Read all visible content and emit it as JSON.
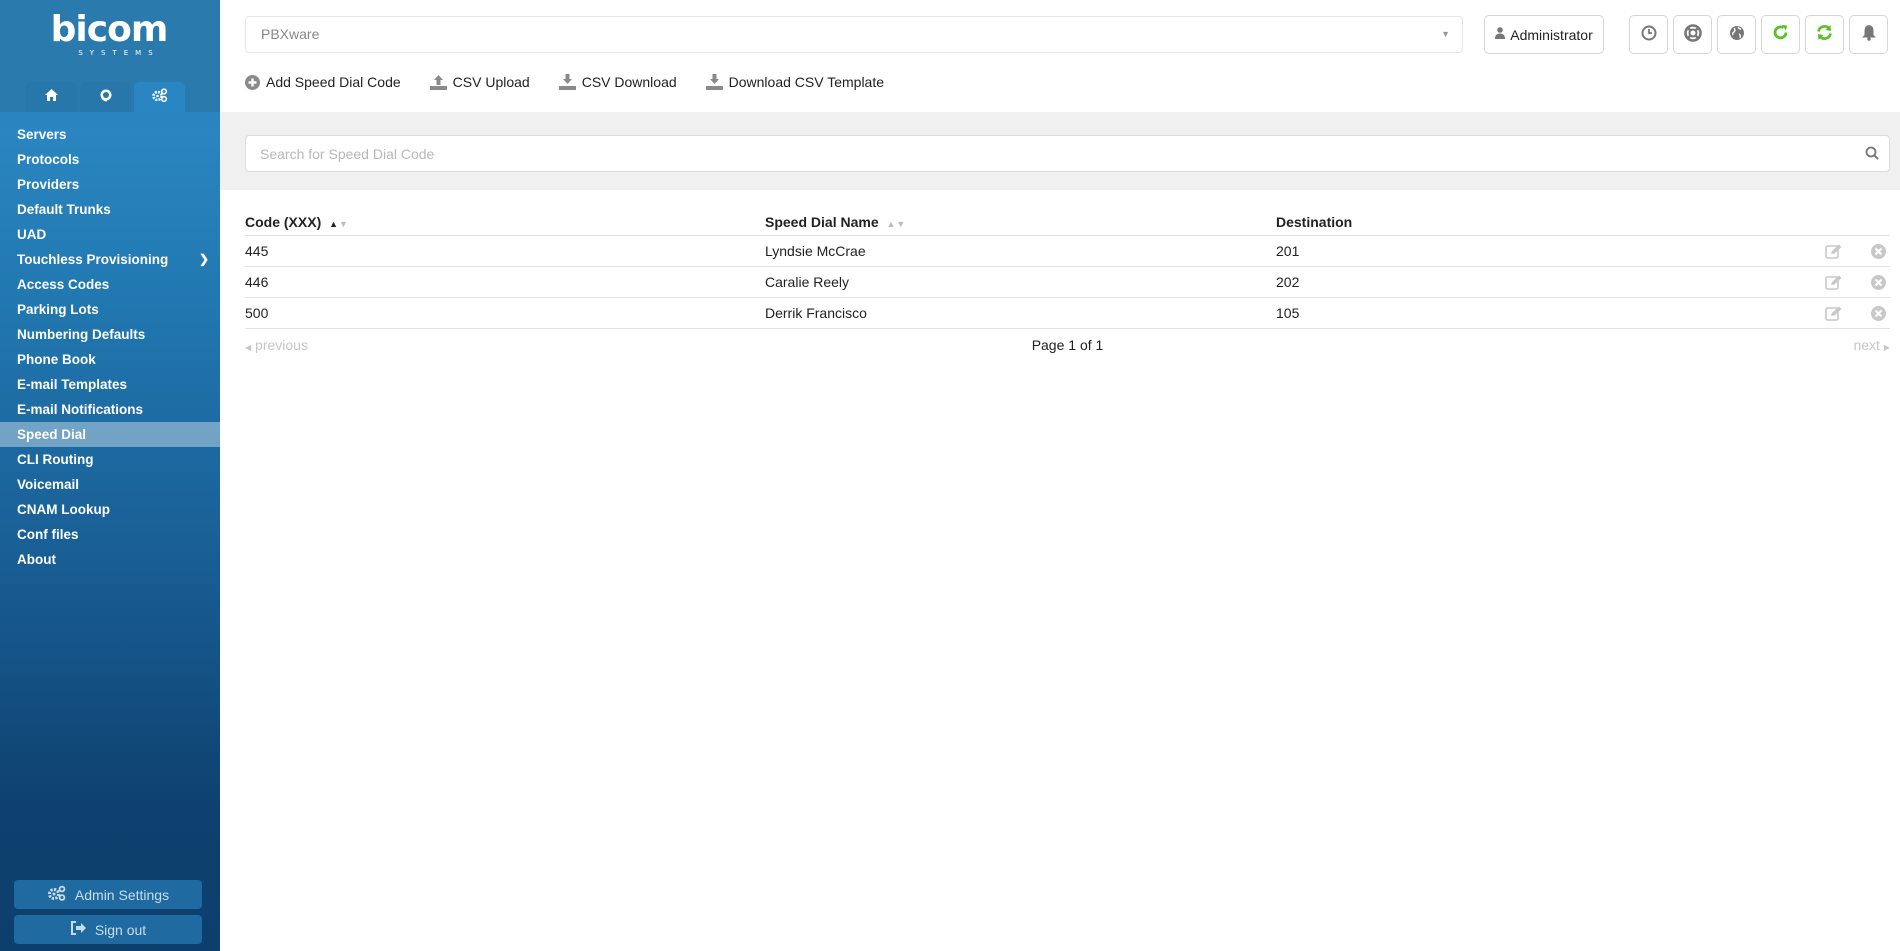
{
  "brand": {
    "name": "bicom",
    "tagline": "SYSTEMS"
  },
  "sidebar": {
    "tabs": [
      {
        "name": "home",
        "icon": "home-icon",
        "active": false
      },
      {
        "name": "support",
        "icon": "headset-icon",
        "active": false
      },
      {
        "name": "settings",
        "icon": "gears-icon",
        "active": true
      }
    ],
    "items": [
      {
        "label": "Servers"
      },
      {
        "label": "Protocols"
      },
      {
        "label": "Providers"
      },
      {
        "label": "Default Trunks"
      },
      {
        "label": "UAD"
      },
      {
        "label": "Touchless Provisioning",
        "has_submenu": true
      },
      {
        "label": "Access Codes"
      },
      {
        "label": "Parking Lots"
      },
      {
        "label": "Numbering Defaults"
      },
      {
        "label": "Phone Book"
      },
      {
        "label": "E-mail Templates"
      },
      {
        "label": "E-mail Notifications"
      },
      {
        "label": "Speed Dial",
        "active": true
      },
      {
        "label": "CLI Routing"
      },
      {
        "label": "Voicemail"
      },
      {
        "label": "CNAM Lookup"
      },
      {
        "label": "Conf files"
      },
      {
        "label": "About"
      }
    ],
    "admin_settings_label": "Admin Settings",
    "sign_out_label": "Sign out"
  },
  "header": {
    "server_select": {
      "value": "PBXware"
    },
    "user_label": "Administrator",
    "icon_buttons": [
      "clock-icon",
      "life-ring-icon",
      "globe-icon",
      "reload-icon",
      "sync-icon",
      "bell-icon"
    ],
    "accent_green": "#5bbf2a"
  },
  "toolbar": {
    "add_label": "Add Speed Dial Code",
    "csv_upload_label": "CSV Upload",
    "csv_download_label": "CSV Download",
    "template_label": "Download CSV Template"
  },
  "search": {
    "placeholder": "Search for Speed Dial Code",
    "value": ""
  },
  "table": {
    "columns": [
      "Code (XXX)",
      "Speed Dial Name",
      "Destination"
    ],
    "sort": {
      "column": "Code (XXX)",
      "direction": "asc"
    },
    "rows": [
      {
        "code": "445",
        "name": "Lyndsie McCrae",
        "destination": "201"
      },
      {
        "code": "446",
        "name": "Caralie Reely",
        "destination": "202"
      },
      {
        "code": "500",
        "name": "Derrik Francisco",
        "destination": "105"
      }
    ]
  },
  "pagination": {
    "prev_label": "previous",
    "info": "Page 1 of 1",
    "next_label": "next"
  }
}
